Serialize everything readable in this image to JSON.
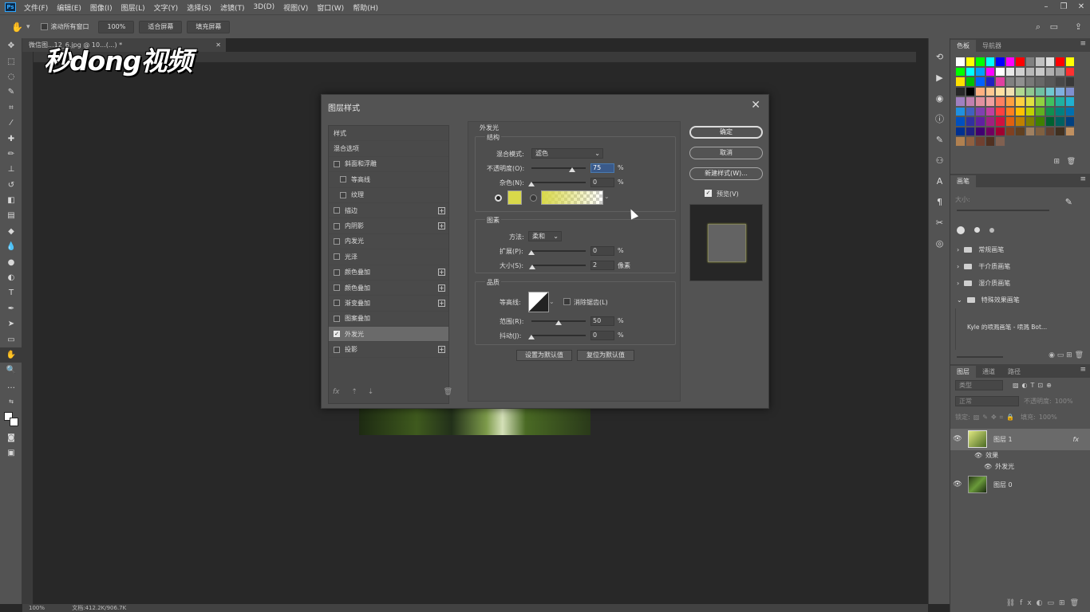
{
  "menu": [
    "文件(F)",
    "编辑(E)",
    "图像(I)",
    "图层(L)",
    "文字(Y)",
    "选择(S)",
    "滤镜(T)",
    "3D(D)",
    "视图(V)",
    "窗口(W)",
    "帮助(H)"
  ],
  "app_badge": "Ps",
  "options_bar": {
    "scroll_all": "滚动所有窗口",
    "zoom": "100%",
    "fit_screen": "适合屏幕",
    "fill_screen": "填充屏幕"
  },
  "doc_tab": "微信图...12_6.jpg @ 10...(...) *",
  "watermark": "秒dong视频",
  "status": {
    "zoom": "100%",
    "doc": "文档:412.2K/906.7K"
  },
  "dialog": {
    "title": "图层样式",
    "style_list": [
      {
        "label": "样式",
        "check": false,
        "plus": false,
        "sub": false,
        "header": true
      },
      {
        "label": "混合选项",
        "check": false,
        "plus": false,
        "sub": false,
        "header": true
      },
      {
        "label": "斜面和浮雕",
        "check": true,
        "on": false,
        "plus": false,
        "sub": false
      },
      {
        "label": "等高线",
        "check": true,
        "on": false,
        "plus": false,
        "sub": true
      },
      {
        "label": "纹理",
        "check": true,
        "on": false,
        "plus": false,
        "sub": true
      },
      {
        "label": "描边",
        "check": true,
        "on": false,
        "plus": true,
        "sub": false
      },
      {
        "label": "内阴影",
        "check": true,
        "on": false,
        "plus": true,
        "sub": false
      },
      {
        "label": "内发光",
        "check": true,
        "on": false,
        "plus": false,
        "sub": false
      },
      {
        "label": "光泽",
        "check": true,
        "on": false,
        "plus": false,
        "sub": false
      },
      {
        "label": "颜色叠加",
        "check": true,
        "on": false,
        "plus": true,
        "sub": false
      },
      {
        "label": "颜色叠加",
        "check": true,
        "on": false,
        "plus": true,
        "sub": false
      },
      {
        "label": "渐变叠加",
        "check": true,
        "on": false,
        "plus": true,
        "sub": false
      },
      {
        "label": "图案叠加",
        "check": true,
        "on": false,
        "plus": false,
        "sub": false
      },
      {
        "label": "外发光",
        "check": true,
        "on": true,
        "plus": false,
        "sub": false,
        "selected": true
      },
      {
        "label": "投影",
        "check": true,
        "on": false,
        "plus": true,
        "sub": false
      }
    ],
    "outer_glow": {
      "section_title": "外发光",
      "structure": {
        "title": "结构",
        "blend_mode_label": "混合模式:",
        "blend_mode": "滤色",
        "opacity_label": "不透明度(O):",
        "opacity": "75",
        "noise_label": "杂色(N):",
        "noise": "0",
        "percent": "%",
        "glow_color": "#d8d84a"
      },
      "elements": {
        "title": "图素",
        "technique_label": "方法:",
        "technique": "柔和",
        "spread_label": "扩展(P):",
        "spread": "0",
        "size_label": "大小(S):",
        "size": "2",
        "px_unit": "像素"
      },
      "quality": {
        "title": "品质",
        "contour_label": "等高线:",
        "antialias_label": "消除锯齿(L)",
        "range_label": "范围(R):",
        "range": "50",
        "jitter_label": "抖动(J):",
        "jitter": "0"
      },
      "make_default": "设置为默认值",
      "reset_default": "复位为默认值"
    },
    "ok": "确定",
    "cancel": "取消",
    "new_style": "新建样式(W)...",
    "preview": "预览(V)"
  },
  "panels": {
    "swatches_tabs": [
      "色板",
      "导航器"
    ],
    "swatch_colors": [
      "#ffffff",
      "#ffff00",
      "#00ff00",
      "#00ffff",
      "#0000ff",
      "#ff00ff",
      "#ff0000",
      "#808080",
      "#c0c0c0",
      "#e0e0e0",
      "#ff0000",
      "#ffff00",
      "#00ff00",
      "#00ffff",
      "#00a0ff",
      "#ff00ff",
      "#ffffff",
      "#e8e8e8",
      "#d0d0d0",
      "#b8b8b8",
      "#c8c8c8",
      "#b0b0b0",
      "#a0a0a0",
      "#ff3030",
      "#ffe000",
      "#00c000",
      "#0060ff",
      "#2020c0",
      "#e040a0",
      "#808080",
      "#909090",
      "#787878",
      "#686868",
      "#585858",
      "#484848",
      "#383838",
      "#282828",
      "#000000",
      "#ffb080",
      "#ffc890",
      "#ffe0a0",
      "#f0e0b0",
      "#b0d890",
      "#90c890",
      "#70c0a0",
      "#70c8d0",
      "#80b0e0",
      "#8090d0",
      "#a080c0",
      "#c080b0",
      "#e090a0",
      "#f0a0a0",
      "#ff8060",
      "#ffa040",
      "#ffd040",
      "#e0e040",
      "#90d040",
      "#40c060",
      "#20b0a0",
      "#20b0d0",
      "#2090e0",
      "#4060c0",
      "#8040b0",
      "#c040a0",
      "#ff4040",
      "#ff8020",
      "#ffc000",
      "#c0d000",
      "#60b020",
      "#109050",
      "#008080",
      "#0070b0",
      "#0050c0",
      "#3030a0",
      "#6020a0",
      "#a02080",
      "#d01040",
      "#e06010",
      "#c08000",
      "#808000",
      "#408000",
      "#006030",
      "#006060",
      "#004080",
      "#003090",
      "#202080",
      "#400070",
      "#700060",
      "#a00030",
      "#804020",
      "#604020",
      "#a08060",
      "#806040",
      "#604030",
      "#403020",
      "#c09060",
      "#b08050",
      "#906040",
      "#704030",
      "#503020",
      "#806050"
    ],
    "brush": {
      "tab": "画笔",
      "size_label": "大小:",
      "folders": [
        "常规画笔",
        "干介质画笔",
        "湿介质画笔",
        "特殊效果画笔"
      ],
      "preset": "Kyle 的喷溅画笔 - 喷溅 Bot..."
    },
    "layers": {
      "tabs": [
        "图层",
        "通道",
        "路径"
      ],
      "kind": "类型",
      "mode": "正常",
      "opacity_label": "不透明度:",
      "opacity": "100%",
      "lock_label": "锁定:",
      "fill_label": "填充:",
      "fill": "100%",
      "items": [
        {
          "name": "图层 1",
          "fx": "fx"
        },
        {
          "name": "效果"
        },
        {
          "name": "外发光"
        },
        {
          "name": "图层 0"
        }
      ]
    }
  }
}
